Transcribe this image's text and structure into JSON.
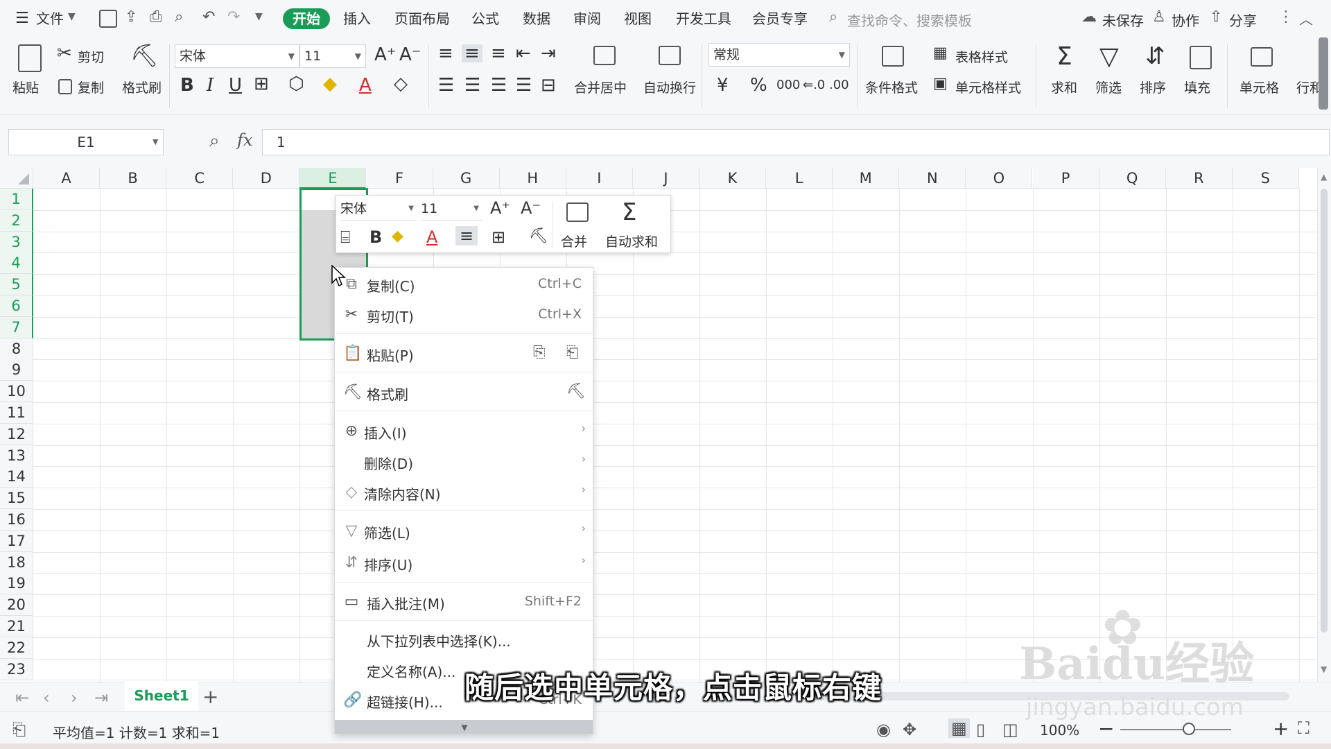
{
  "menubar": {
    "file": "文件",
    "tabs": [
      "开始",
      "插入",
      "页面布局",
      "公式",
      "数据",
      "审阅",
      "视图",
      "开发工具",
      "会员专享"
    ],
    "active_tab": "开始",
    "search_placeholder": "查找命令、搜索模板",
    "unsaved": "未保存",
    "collab": "协作",
    "share": "分享"
  },
  "ribbon": {
    "paste": "粘贴",
    "cut": "剪切",
    "copy": "复制",
    "format_painter": "格式刷",
    "font_name": "宋体",
    "font_size": "11",
    "merge_center": "合并居中",
    "wrap_text": "自动换行",
    "number_format": "常规",
    "currency_symbol": "¥",
    "percent_symbol": "%",
    "thousands": "000",
    "cond_format": "条件格式",
    "table_style": "表格样式",
    "cell_style": "单元格样式",
    "sum": "求和",
    "filter": "筛选",
    "sort": "排序",
    "fill": "填充",
    "cell": "单元格",
    "row_col": "行和"
  },
  "formula_bar": {
    "cell_ref": "E1",
    "fx": "fx",
    "value": "1"
  },
  "grid": {
    "columns": [
      "A",
      "B",
      "C",
      "D",
      "E",
      "F",
      "G",
      "H",
      "I",
      "J",
      "K",
      "L",
      "M",
      "N",
      "O",
      "P",
      "Q",
      "R",
      "S"
    ],
    "selected_column": "E",
    "rows": [
      "1",
      "2",
      "3",
      "4",
      "5",
      "6",
      "7",
      "8",
      "9",
      "10",
      "11",
      "12",
      "13",
      "14",
      "15",
      "16",
      "17",
      "18",
      "19",
      "20",
      "21",
      "22",
      "23"
    ],
    "selected_rows": [
      "1",
      "2",
      "3",
      "4",
      "5",
      "6",
      "7"
    ]
  },
  "mini_toolbar": {
    "font_name": "宋体",
    "font_size": "11",
    "merge": "合并",
    "autosum": "自动求和"
  },
  "context_menu": {
    "copy": {
      "label": "复制(C)",
      "shortcut": "Ctrl+C"
    },
    "cut": {
      "label": "剪切(T)",
      "shortcut": "Ctrl+X"
    },
    "paste": {
      "label": "粘贴(P)"
    },
    "format_painter": {
      "label": "格式刷"
    },
    "insert": {
      "label": "插入(I)"
    },
    "delete": {
      "label": "删除(D)"
    },
    "clear": {
      "label": "清除内容(N)"
    },
    "filter": {
      "label": "筛选(L)"
    },
    "sort": {
      "label": "排序(U)"
    },
    "comment": {
      "label": "插入批注(M)",
      "shortcut": "Shift+F2"
    },
    "pick_list": {
      "label": "从下拉列表中选择(K)..."
    },
    "define_name": {
      "label": "定义名称(A)..."
    },
    "hyperlink": {
      "label": "超链接(H)...",
      "shortcut": "Ctrl+K"
    }
  },
  "sheets": {
    "active": "Sheet1"
  },
  "status": {
    "summary": "平均值=1  计数=1  求和=1",
    "zoom": "100%"
  },
  "subtitle": "随后选中单元格，点击鼠标右键",
  "watermark": {
    "brand": "Baidu经验",
    "url": "jingyan.baidu.com"
  },
  "colors": {
    "accent": "#1a9c57",
    "selection_fill": "#d9d9d9"
  }
}
